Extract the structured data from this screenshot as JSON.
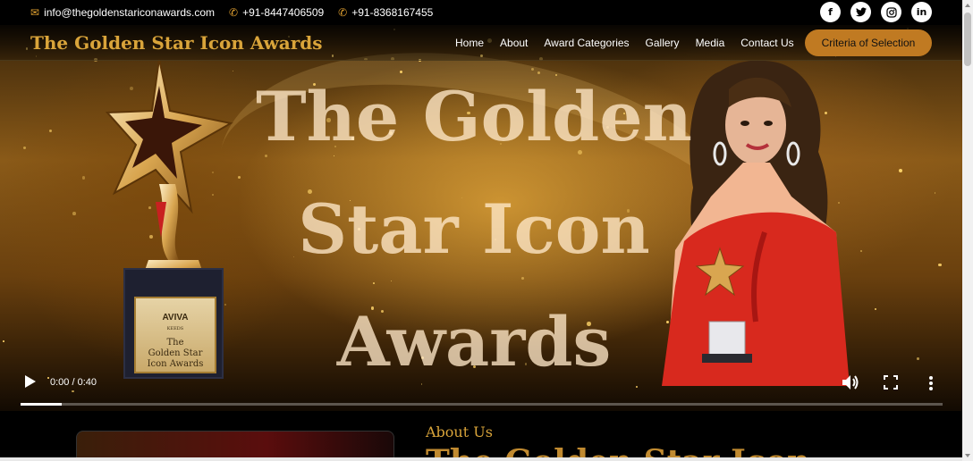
{
  "topbar": {
    "email": "info@thegoldenstariconawards.com",
    "phone1": "+91-8447406509",
    "phone2": "+91-8368167455",
    "socials": [
      {
        "icon": "facebook-icon",
        "glyph": "f"
      },
      {
        "icon": "twitter-icon",
        "glyph": "t"
      },
      {
        "icon": "instagram-icon",
        "glyph": "◎"
      },
      {
        "icon": "linkedin-icon",
        "glyph": "in"
      }
    ]
  },
  "nav": {
    "logo": "The Golden Star Icon Awards",
    "items": [
      "Home",
      "About",
      "Award Categories",
      "Gallery",
      "Media",
      "Contact Us"
    ],
    "cta": "Criteria of Selection"
  },
  "hero": {
    "headline_line1": "The Golden",
    "headline_line2": "Star Icon",
    "headline_line3": "Awards",
    "plaque_brand": "AVIVA",
    "plaque_brand_sub": "KEEDS",
    "plaque_line1": "The",
    "plaque_line2": "Golden Star",
    "plaque_line3": "Icon Awards"
  },
  "video": {
    "time": "0:00 / 0:40",
    "progress_fraction": 0.045
  },
  "about": {
    "label": "About Us",
    "title": "The Golden Star Icon"
  },
  "colors": {
    "gold": "#d9a43a",
    "cta": "#c07a22"
  }
}
